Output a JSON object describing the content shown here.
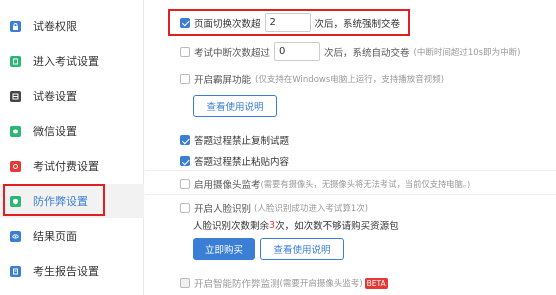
{
  "sidebar": {
    "items": [
      {
        "label": "试卷权限",
        "icon": "lock-icon",
        "color": "#3a7fd5"
      },
      {
        "label": "进入考试设置",
        "icon": "document-icon",
        "color": "#2bb673"
      },
      {
        "label": "试卷设置",
        "icon": "grid-icon",
        "color": "#333333"
      },
      {
        "label": "微信设置",
        "icon": "wechat-icon",
        "color": "#2bb673"
      },
      {
        "label": "考试付费设置",
        "icon": "payment-icon",
        "color": "#e53935"
      },
      {
        "label": "防作弊设置",
        "icon": "shield-icon",
        "color": "#2bb673",
        "active": true
      },
      {
        "label": "结果页面",
        "icon": "eye-icon",
        "color": "#3a7fd5"
      },
      {
        "label": "考生报告设置",
        "icon": "report-icon",
        "color": "#3a7fd5"
      }
    ]
  },
  "settings": {
    "switch_limit": {
      "label": "页面切换次数超",
      "value": "2",
      "suffix": "次后，系统强制交卷"
    },
    "pause_limit": {
      "label": "考试中断次数超过",
      "value": "0",
      "suffix": "次后，系统自动交卷",
      "hint": "(中断时间超过10s即为中断)"
    },
    "lock_screen": {
      "label": "开启霸屏功能",
      "hint": "(仅支持在Windows电脑上运行，支持播放音视频)",
      "button": "查看使用说明"
    },
    "no_copy": {
      "label": "答题过程禁止复制试题"
    },
    "no_paste": {
      "label": "答题过程禁止粘贴内容"
    },
    "camera": {
      "label": "启用摄像头监考",
      "hint": "(需要有摄像头，无摄像头将无法考试，当前仅支持电脑。)"
    },
    "face_id": {
      "label": "开启人脸识别",
      "hint": "(人脸识别成功进入考试算1次)",
      "remain_prefix": "人脸识别次数剩余",
      "remain_count": "3",
      "remain_suffix": "次，如次数不够请购买资源包",
      "buy_button": "立即购买",
      "guide_button": "查看使用说明"
    },
    "smart_monitor": {
      "label": "开启智能防作弊监测",
      "hint": "(需要开启摄像头监考)",
      "badge": "BETA"
    }
  }
}
